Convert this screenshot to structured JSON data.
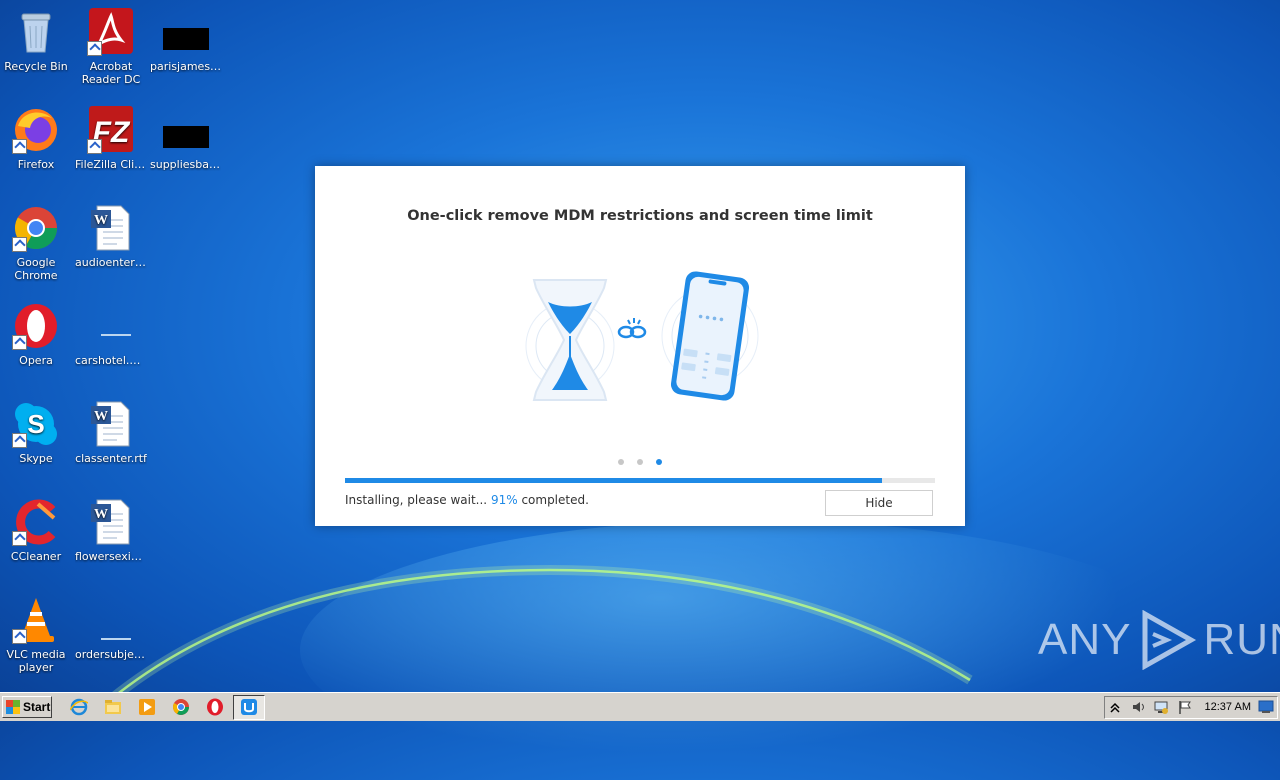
{
  "desktop": {
    "icons": [
      {
        "label": "Recycle Bin"
      },
      {
        "label": "Acrobat Reader DC"
      },
      {
        "label": "parisjames.jpg"
      },
      {
        "label": "Firefox"
      },
      {
        "label": "FileZilla Client"
      },
      {
        "label": "suppliesbas..."
      },
      {
        "label": "Google Chrome"
      },
      {
        "label": "audioentert..."
      },
      {
        "label": "Opera"
      },
      {
        "label": "carshotel.png"
      },
      {
        "label": "Skype"
      },
      {
        "label": "classenter.rtf"
      },
      {
        "label": "CCleaner"
      },
      {
        "label": "flowersexis..."
      },
      {
        "label": "VLC media player"
      },
      {
        "label": "ordersubjec..."
      }
    ]
  },
  "dialog": {
    "title": "One-click remove MDM restrictions and screen time limit",
    "carousel_pages": 3,
    "carousel_active": 3,
    "progress_percent": 91,
    "status_prefix": "Installing, please wait...",
    "status_percent": "91%",
    "status_suffix": "completed.",
    "hide_label": "Hide"
  },
  "watermark": {
    "left": "ANY",
    "right": "RUN"
  },
  "taskbar": {
    "start_label": "Start",
    "clock": "12:37 AM"
  },
  "colors": {
    "accent": "#1f8ae6",
    "desktop_blue": "#1a74d8",
    "taskbar": "#d6d3ce"
  }
}
